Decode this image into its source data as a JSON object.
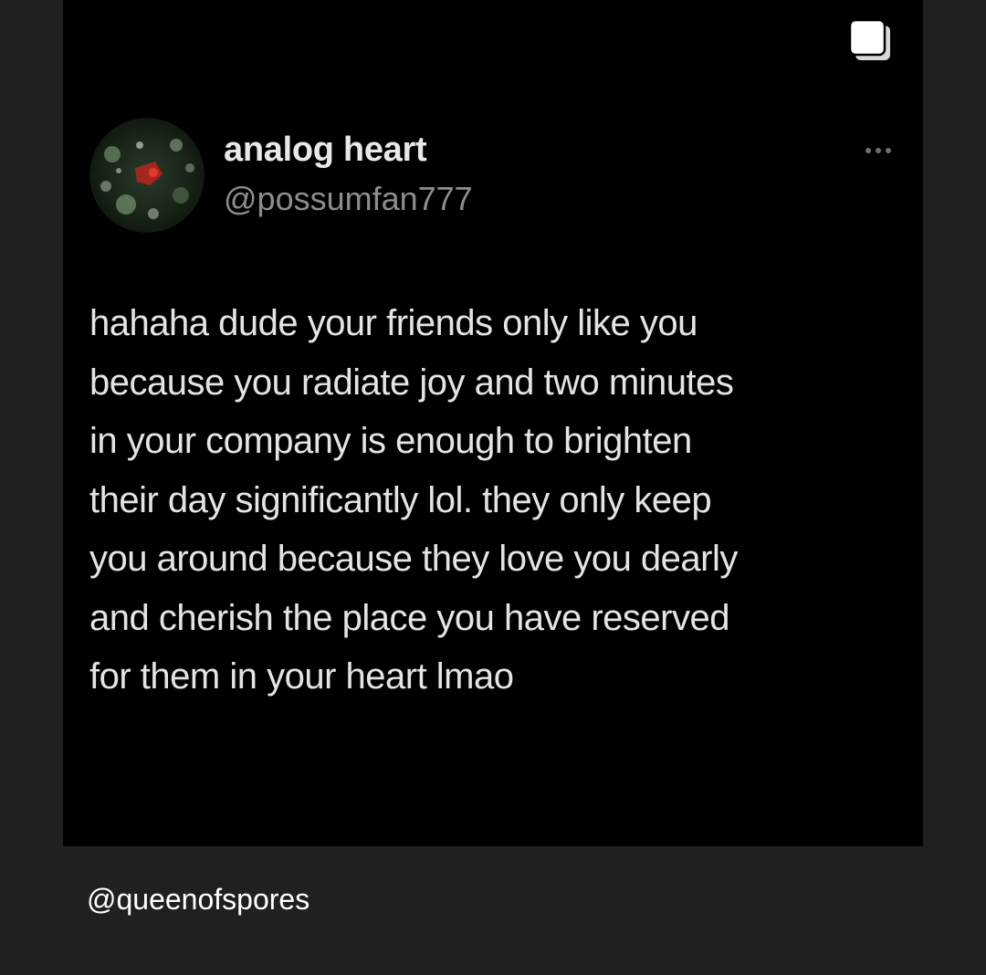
{
  "post": {
    "display_name": "analog heart",
    "handle": "@possumfan777",
    "text": "hahaha dude your friends only like you\nbecause you radiate joy and two minutes\nin your company is enough to brighten\ntheir day significantly lol. they only keep\nyou around because they love you dearly\nand cherish the place you have reserved\nfor them in your heart lmao",
    "icons": {
      "multi_image": "multiple-images-icon",
      "more": "more-options-icon",
      "avatar": "avatar"
    }
  },
  "credit": "@queenofspores",
  "colors": {
    "page_background": "#202020",
    "card_background": "#000000",
    "primary_text": "#e4e4e4",
    "secondary_text": "#8d8d8d"
  }
}
